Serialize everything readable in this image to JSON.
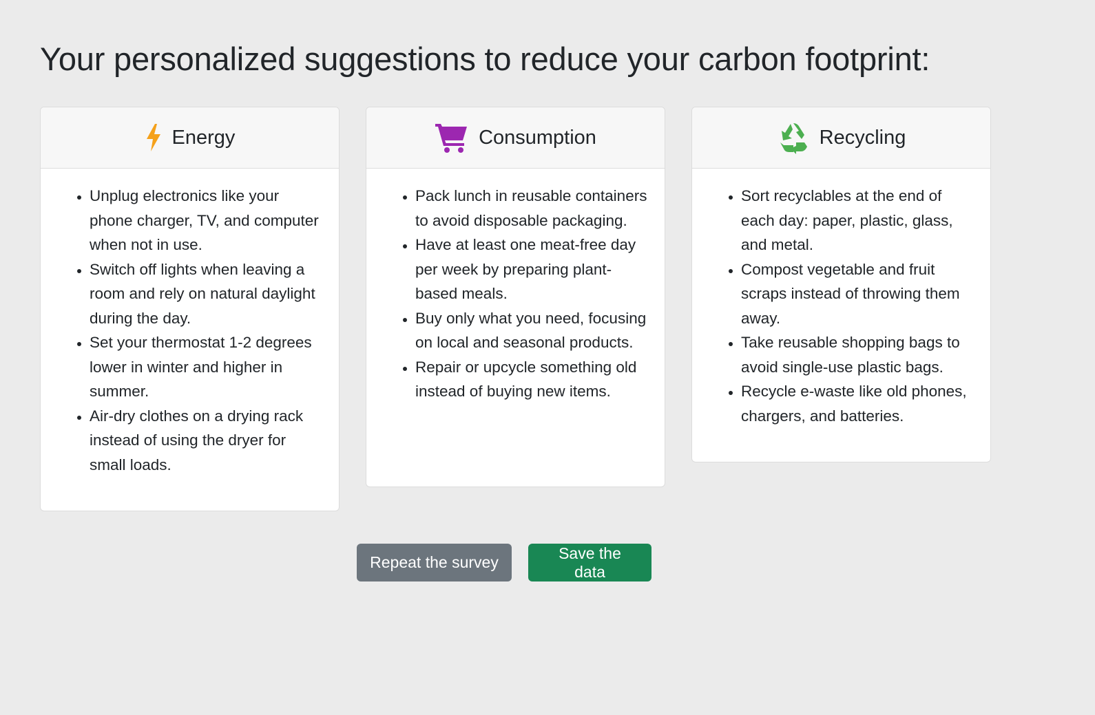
{
  "page": {
    "title": "Your personalized suggestions to reduce your carbon footprint:"
  },
  "cards": [
    {
      "title": "Energy",
      "icon": "lightning-bolt-icon",
      "icon_color": "#f5a11b",
      "items": [
        "Unplug electronics like your phone charger, TV, and computer when not in use.",
        "Switch off lights when leaving a room and rely on natural daylight during the day.",
        "Set your thermostat 1-2 degrees lower in winter and higher in summer.",
        "Air-dry clothes on a drying rack instead of using the dryer for small loads."
      ]
    },
    {
      "title": "Consumption",
      "icon": "shopping-cart-icon",
      "icon_color": "#9c27b0",
      "items": [
        "Pack lunch in reusable containers to avoid disposable packaging.",
        "Have at least one meat-free day per week by preparing plant-based meals.",
        "Buy only what you need, focusing on local and seasonal products.",
        "Repair or upcycle something old instead of buying new items."
      ]
    },
    {
      "title": "Recycling",
      "icon": "recycle-icon",
      "icon_color": "#4caf50",
      "items": [
        "Sort recyclables at the end of each day: paper, plastic, glass, and metal.",
        "Compost vegetable and fruit scraps instead of throwing them away.",
        "Take reusable shopping bags to avoid single-use plastic bags.",
        "Recycle e-waste like old phones, chargers, and batteries."
      ]
    }
  ],
  "buttons": {
    "repeat_label": "Repeat the survey",
    "save_label": "Save the data"
  },
  "colors": {
    "background": "#ebebeb",
    "secondary_button": "#6c757d",
    "success_button": "#198754"
  }
}
